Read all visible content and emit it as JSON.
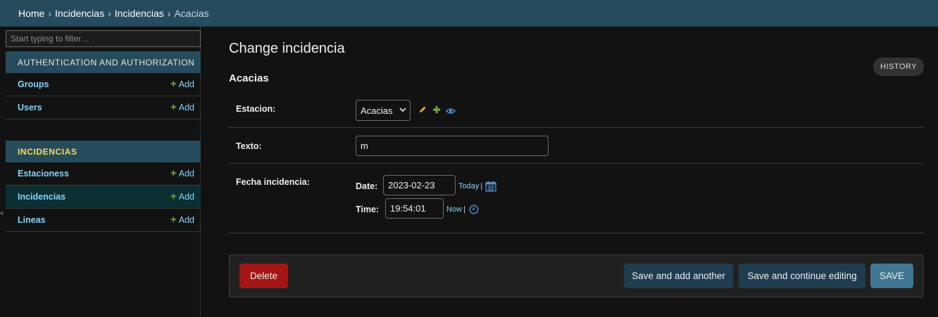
{
  "breadcrumb": {
    "items": [
      "Home",
      "Incidencias",
      "Incidencias"
    ],
    "separator": "›",
    "current": "Acacias"
  },
  "sidebar": {
    "filter_placeholder": "Start typing to filter…",
    "modules": [
      {
        "caption": "AUTHENTICATION AND AUTHORIZATION",
        "models": [
          {
            "name": "Groups",
            "add": "Add"
          },
          {
            "name": "Users",
            "add": "Add"
          }
        ]
      },
      {
        "caption": "INCIDENCIAS",
        "models": [
          {
            "name": "Estacioness",
            "add": "Add"
          },
          {
            "name": "Incidencias",
            "add": "Add",
            "selected": true
          },
          {
            "name": "Lineas",
            "add": "Add"
          }
        ]
      }
    ],
    "toggle_glyph": "«"
  },
  "main": {
    "title": "Change incidencia",
    "history_label": "HISTORY",
    "object_title": "Acacias",
    "fields": {
      "estacion": {
        "label": "Estacion:",
        "value": "Acacias",
        "icons": [
          "pencil-icon",
          "plus-icon",
          "eye-icon"
        ]
      },
      "texto": {
        "label": "Texto:",
        "value": "m"
      },
      "fecha": {
        "label": "Fecha incidencia:",
        "date_label": "Date:",
        "date_value": "2023-02-23",
        "today_label": "Today",
        "time_label": "Time:",
        "time_value": "19:54:01",
        "now_label": "Now",
        "pipe": "|"
      }
    },
    "submit": {
      "delete": "Delete",
      "save_add_another": "Save and add another",
      "save_continue": "Save and continue editing",
      "save": "SAVE"
    }
  },
  "colors": {
    "header_bg": "#264b5d",
    "link": "#81d4fa",
    "add_plus": "#6ea936",
    "delete": "#a41515",
    "save": "#417690",
    "secondary_button": "#1f3d4e",
    "selected_row": "#0c2f33"
  }
}
